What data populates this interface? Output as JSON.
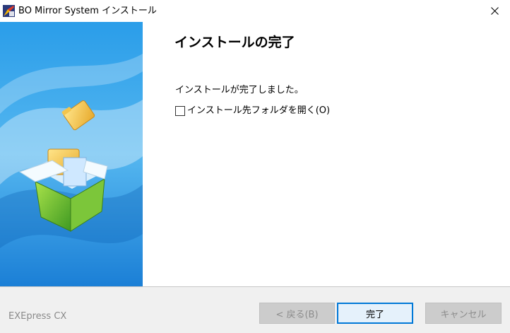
{
  "window": {
    "title": "BO Mirror System インストール"
  },
  "icons": {
    "app": "installer-app-icon",
    "close": "close-icon",
    "banner": "open-box-with-folders-illustration"
  },
  "content": {
    "heading": "インストールの完了",
    "message": "インストールが完了しました。",
    "checkbox_label": "インストール先フォルダを開く(O)",
    "checkbox_checked": false
  },
  "footer": {
    "brand": "EXEpress CX",
    "back_label": "< 戻る(B)",
    "finish_label": "完了",
    "cancel_label": "キャンセル"
  },
  "colors": {
    "banner_blue": "#1e90e8",
    "banner_light": "#bfe4fb",
    "focus_border": "#0078d7",
    "footer_bg": "#f0f0f0"
  }
}
